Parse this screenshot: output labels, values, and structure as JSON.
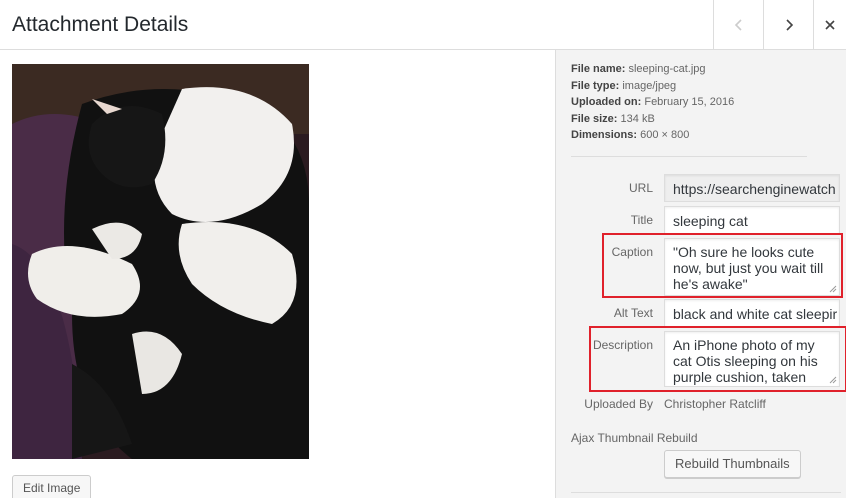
{
  "header": {
    "title": "Attachment Details",
    "prev_icon": "chevron-left-icon",
    "next_icon": "chevron-right-icon",
    "close_icon": "close-icon"
  },
  "image_pane": {
    "edit_button": "Edit Image"
  },
  "file_info": {
    "name_label": "File name:",
    "name_value": "sleeping-cat.jpg",
    "type_label": "File type:",
    "type_value": "image/jpeg",
    "uploaded_label": "Uploaded on:",
    "uploaded_value": "February 15, 2016",
    "size_label": "File size:",
    "size_value": "134 kB",
    "dimensions_label": "Dimensions:",
    "dimensions_value": "600 × 800"
  },
  "fields": {
    "url": {
      "label": "URL",
      "value": "https://searchenginewatch"
    },
    "title": {
      "label": "Title",
      "value": "sleeping cat"
    },
    "caption": {
      "label": "Caption",
      "value": "\"Oh sure he looks cute now, but just you wait till he's awake\""
    },
    "alt_text": {
      "label": "Alt Text",
      "value": "black and white cat sleepir"
    },
    "description": {
      "label": "Description",
      "value": "An iPhone photo of my cat Otis sleeping on his purple cushion, taken late in the afternoon"
    }
  },
  "uploaded_by": {
    "label": "Uploaded By",
    "value": "Christopher Ratcliff"
  },
  "rebuild": {
    "label": "Ajax Thumbnail Rebuild",
    "button": "Rebuild Thumbnails"
  },
  "colors": {
    "highlight": "#e0212b",
    "sidebar_bg": "#f3f3f3"
  }
}
